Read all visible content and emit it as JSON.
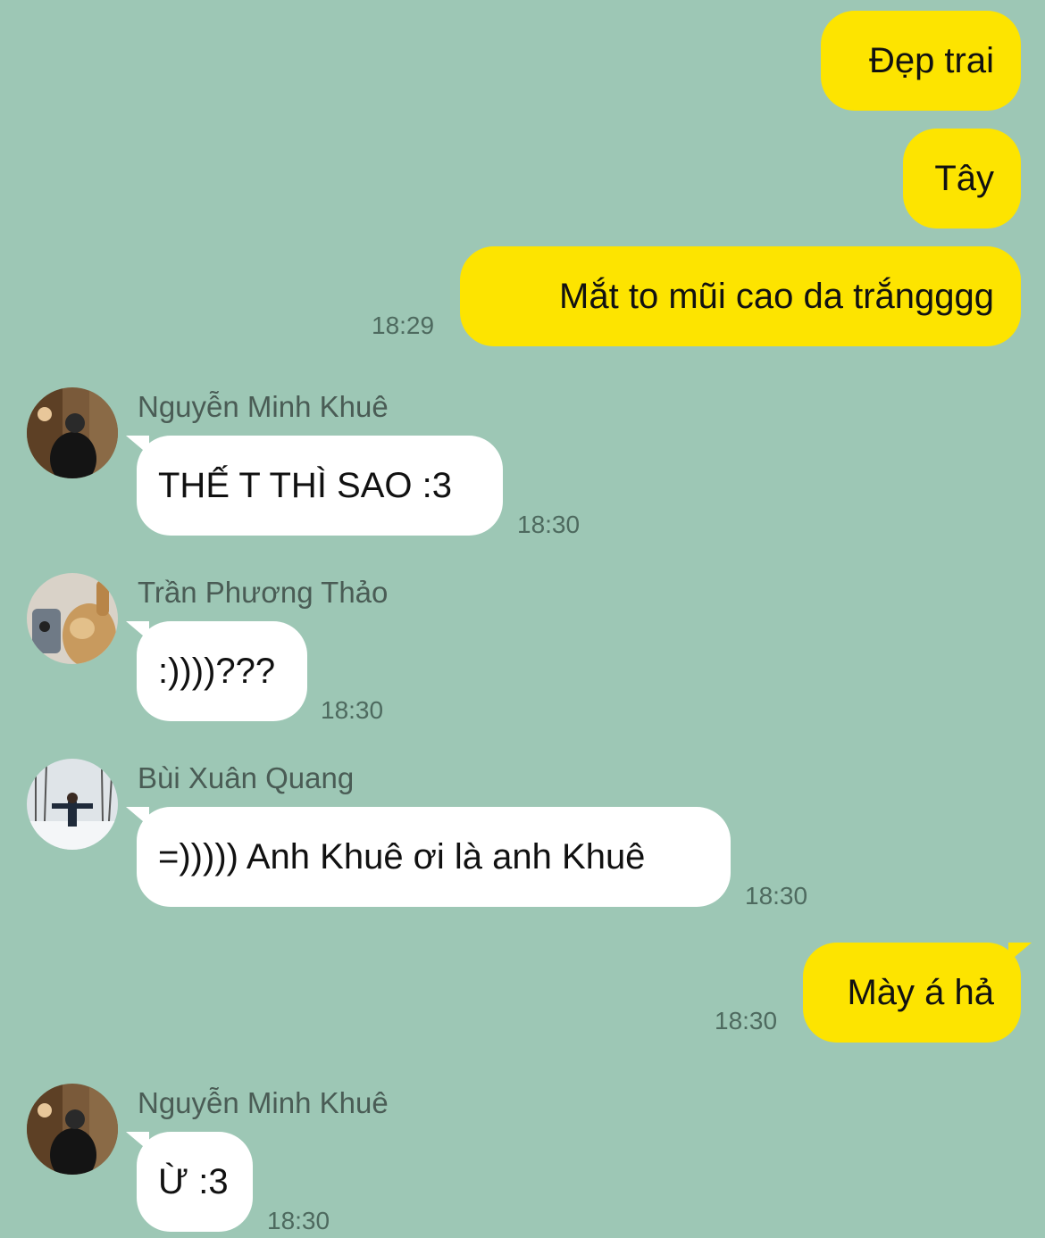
{
  "messages": [
    {
      "dir": "out",
      "text": "Đẹp trai"
    },
    {
      "dir": "out",
      "text": "Tây"
    },
    {
      "dir": "out",
      "text": "Mắt to mũi cao da trắngggg",
      "time": "18:29"
    },
    {
      "dir": "in",
      "sender": "Nguyễn Minh Khuê",
      "text": "THẾ T THÌ SAO :3",
      "time": "18:30",
      "avatar_icon": "user-avatar-photo"
    },
    {
      "dir": "in",
      "sender": "Trần Phương Thảo",
      "text": ":))))???",
      "time": "18:30",
      "avatar_icon": "cat-avatar-photo"
    },
    {
      "dir": "in",
      "sender": "Bùi Xuân Quang",
      "text": "=))))) Anh Khuê ơi là anh Khuê",
      "time": "18:30",
      "avatar_icon": "snow-avatar-photo"
    },
    {
      "dir": "out",
      "text": "Mày á hả",
      "time": "18:30"
    },
    {
      "dir": "in",
      "sender": "Nguyễn Minh Khuê",
      "text": "Ừ :3",
      "time": "18:30",
      "avatar_icon": "user-avatar-photo"
    }
  ],
  "colors": {
    "background": "#9dc7b5",
    "outgoing_bubble": "#fde400",
    "incoming_bubble": "#ffffff",
    "timestamp": "#4e6a5f",
    "sender_name": "#4a5c55"
  }
}
